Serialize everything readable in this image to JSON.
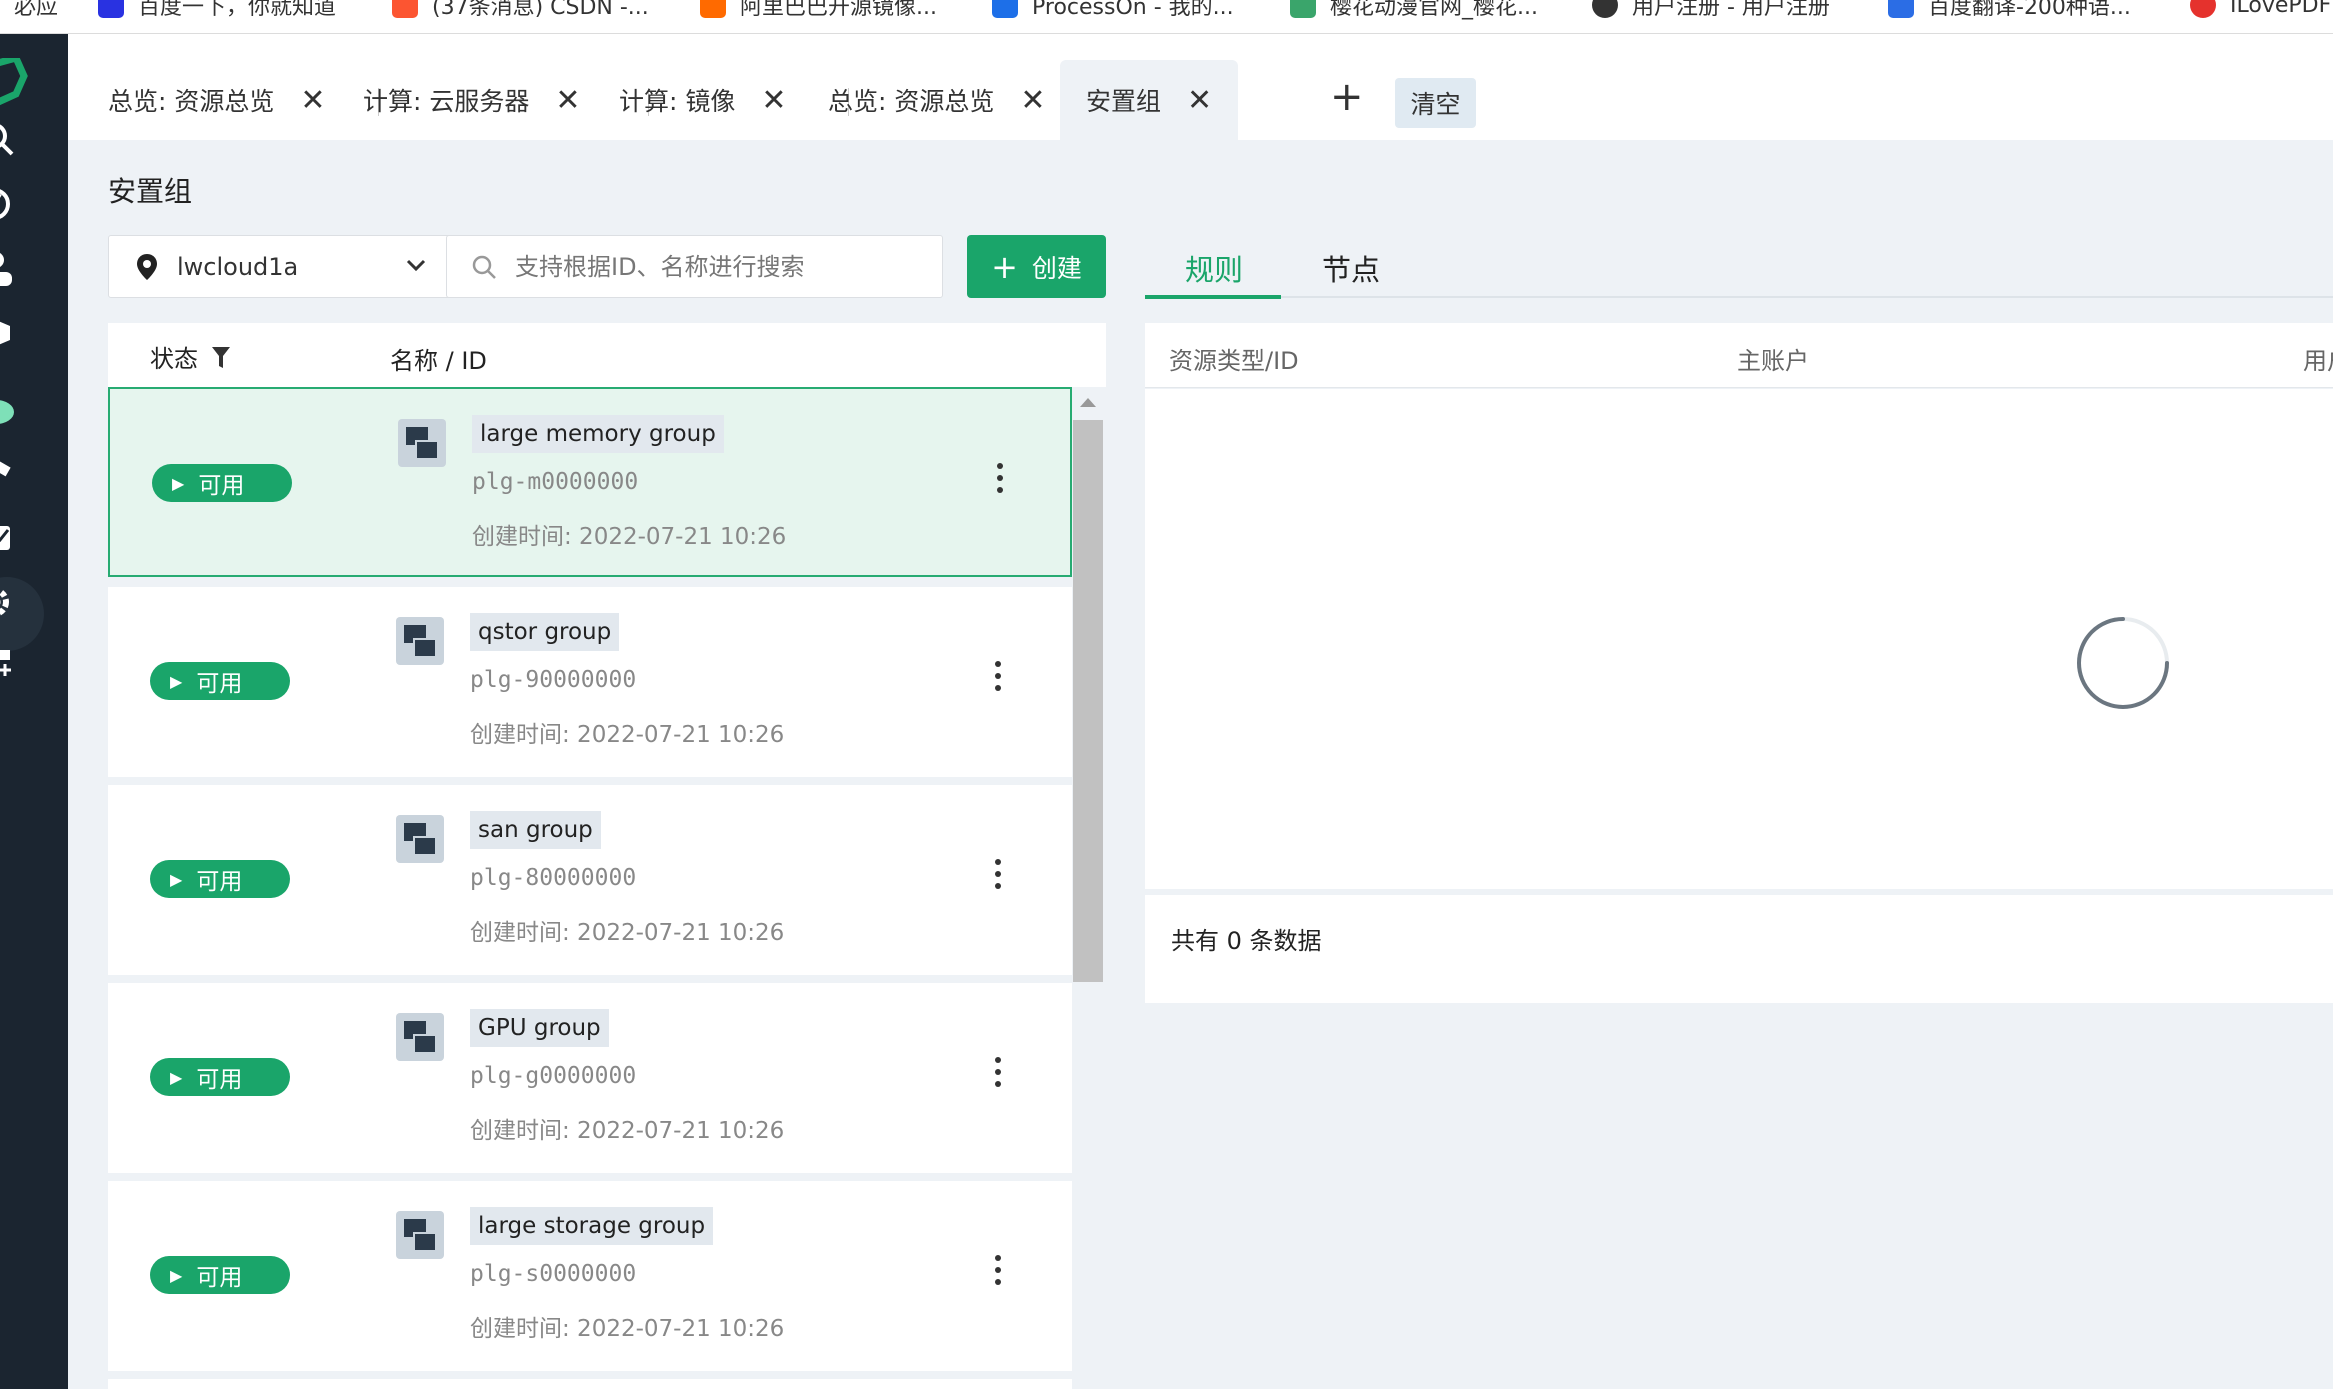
{
  "bookmarks": [
    {
      "label": "必应",
      "color": "#ffffff"
    },
    {
      "label": "百度一下，你就知道",
      "color": "#2932e1"
    },
    {
      "label": "(37条消息) CSDN -...",
      "color": "#fc5531"
    },
    {
      "label": "阿里巴巴开源镜像...",
      "color": "#ff6a00"
    },
    {
      "label": "ProcessOn - 我的...",
      "color": "#1d6fe8"
    },
    {
      "label": "樱花动漫官网_樱花...",
      "color": "#3aa56b"
    },
    {
      "label": "用户注册 - 用户注册",
      "color": "#333333"
    },
    {
      "label": "百度翻译-200种语...",
      "color": "#2b6de5"
    },
    {
      "label": "ILovePDF",
      "color": "#e5322d"
    }
  ],
  "tabs": [
    {
      "label": "总览: 资源总览"
    },
    {
      "label": "计算: 云服务器"
    },
    {
      "label": "计算: 镜像"
    },
    {
      "label": "总览: 资源总览"
    },
    {
      "label": "安置组"
    }
  ],
  "tab_add_label": "+",
  "tab_clear_label": "清空",
  "page_title": "安置组",
  "region": {
    "value": "lwcloud1a"
  },
  "search": {
    "placeholder": "支持根据ID、名称进行搜索"
  },
  "create_label": "创建",
  "list_header": {
    "status": "状态",
    "name": "名称 / ID"
  },
  "groups": [
    {
      "status": "可用",
      "name": "large memory group",
      "id": "plg-m0000000",
      "created": "创建时间: 2022-07-21 10:26"
    },
    {
      "status": "可用",
      "name": "qstor group",
      "id": "plg-90000000",
      "created": "创建时间: 2022-07-21 10:26"
    },
    {
      "status": "可用",
      "name": "san group",
      "id": "plg-80000000",
      "created": "创建时间: 2022-07-21 10:26"
    },
    {
      "status": "可用",
      "name": "GPU group",
      "id": "plg-g0000000",
      "created": "创建时间: 2022-07-21 10:26"
    },
    {
      "status": "可用",
      "name": "large storage group",
      "id": "plg-s0000000",
      "created": "创建时间: 2022-07-21 10:26"
    }
  ],
  "right_tabs": [
    {
      "label": "规则"
    },
    {
      "label": "节点"
    }
  ],
  "right_table": {
    "headers": [
      "资源类型/ID",
      "主账户",
      "用户"
    ],
    "footer": "共有 0 条数据"
  },
  "colors": {
    "accent": "#1aa56a",
    "sidebar": "#1b2530",
    "selected_bg": "#e6f5ee"
  }
}
